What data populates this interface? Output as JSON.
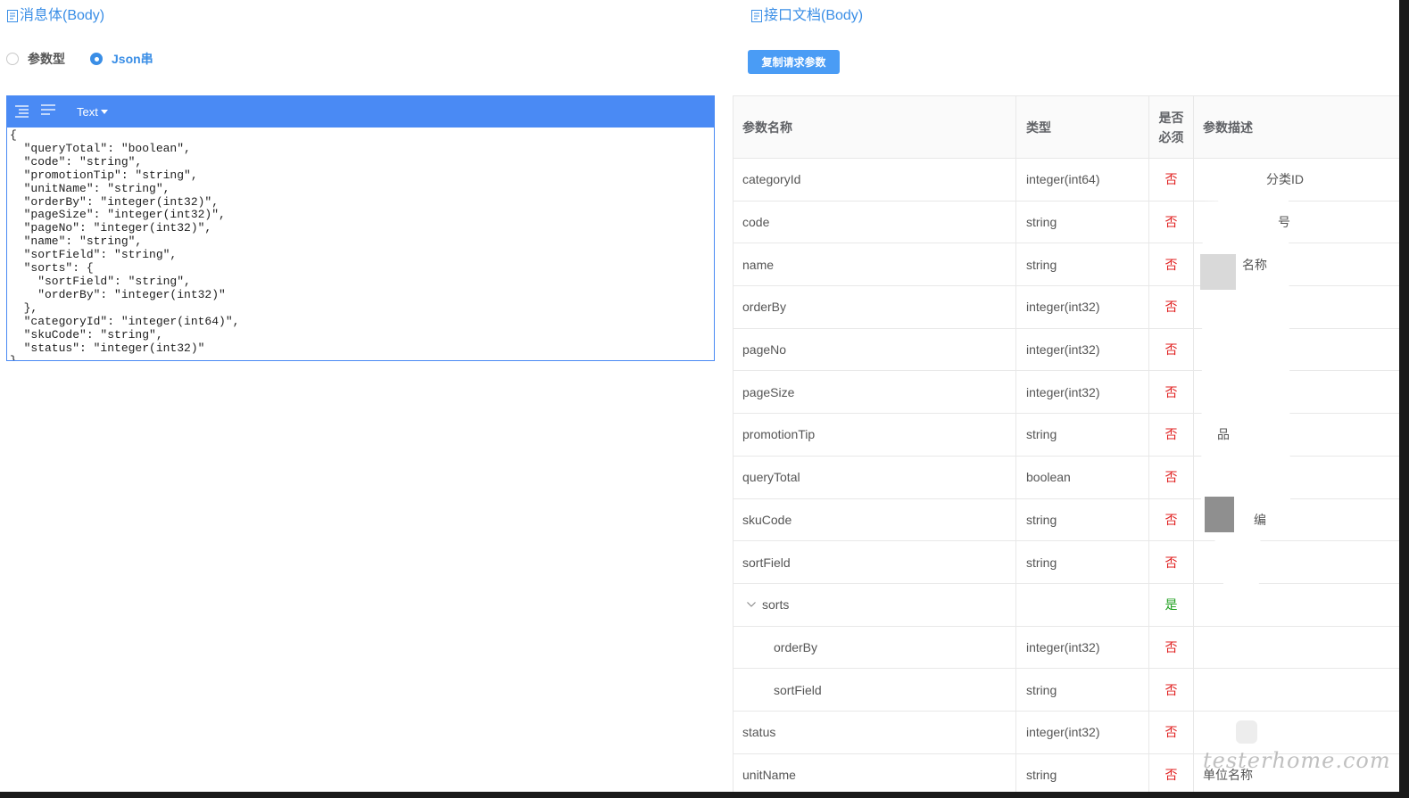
{
  "theme": {
    "accent": "#3a8ee6",
    "toolbar": "#4a8af4",
    "button": "#4a9cf5",
    "required_no": "#e02020",
    "required_yes": "#1b9e1b",
    "border": "#e8e8e8"
  },
  "left_panel": {
    "title": "消息体(Body)",
    "title_icon": "document-icon",
    "body_type": {
      "options": [
        "参数型",
        "Json串"
      ],
      "selected": "Json串"
    },
    "editor": {
      "toolbar": {
        "format_icon": "format-icon",
        "compact_icon": "compact-icon",
        "mode": "Text",
        "mode_icon": "caret-down-icon"
      },
      "content": "{\n  \"queryTotal\": \"boolean\",\n  \"code\": \"string\",\n  \"promotionTip\": \"string\",\n  \"unitName\": \"string\",\n  \"orderBy\": \"integer(int32)\",\n  \"pageSize\": \"integer(int32)\",\n  \"pageNo\": \"integer(int32)\",\n  \"name\": \"string\",\n  \"sortField\": \"string\",\n  \"sorts\": {\n    \"sortField\": \"string\",\n    \"orderBy\": \"integer(int32)\"\n  },\n  \"categoryId\": \"integer(int64)\",\n  \"skuCode\": \"string\",\n  \"status\": \"integer(int32)\"\n}"
    }
  },
  "right_panel": {
    "title": "接口文档(Body)",
    "title_icon": "document-icon",
    "copy_button": "复制请求参数",
    "table": {
      "headers": {
        "name": "参数名称",
        "type": "类型",
        "required": "是否必须",
        "description": "参数描述"
      },
      "rows": [
        {
          "name": "categoryId",
          "type": "integer(int64)",
          "required": "否",
          "description": "分类ID",
          "depth": 0
        },
        {
          "name": "code",
          "type": "string",
          "required": "否",
          "description": "号",
          "depth": 0
        },
        {
          "name": "name",
          "type": "string",
          "required": "否",
          "description": "名称",
          "depth": 0
        },
        {
          "name": "orderBy",
          "type": "integer(int32)",
          "required": "否",
          "description": "",
          "depth": 0
        },
        {
          "name": "pageNo",
          "type": "integer(int32)",
          "required": "否",
          "description": "",
          "depth": 0
        },
        {
          "name": "pageSize",
          "type": "integer(int32)",
          "required": "否",
          "description": "",
          "depth": 0
        },
        {
          "name": "promotionTip",
          "type": "string",
          "required": "否",
          "description": "品",
          "depth": 0
        },
        {
          "name": "queryTotal",
          "type": "boolean",
          "required": "否",
          "description": "",
          "depth": 0
        },
        {
          "name": "skuCode",
          "type": "string",
          "required": "否",
          "description": "编",
          "depth": 0
        },
        {
          "name": "sortField",
          "type": "string",
          "required": "否",
          "description": "",
          "depth": 0
        },
        {
          "name": "sorts",
          "type": "",
          "required": "是",
          "description": "",
          "depth": 0,
          "expanded": true,
          "icon": "chevron-down-icon"
        },
        {
          "name": "orderBy",
          "type": "integer(int32)",
          "required": "否",
          "description": "",
          "depth": 1
        },
        {
          "name": "sortField",
          "type": "string",
          "required": "否",
          "description": "",
          "depth": 1
        },
        {
          "name": "status",
          "type": "integer(int32)",
          "required": "否",
          "description": "",
          "depth": 0
        },
        {
          "name": "unitName",
          "type": "string",
          "required": "否",
          "description": "单位名称",
          "depth": 0
        }
      ]
    }
  },
  "watermark": "testerhome.com"
}
